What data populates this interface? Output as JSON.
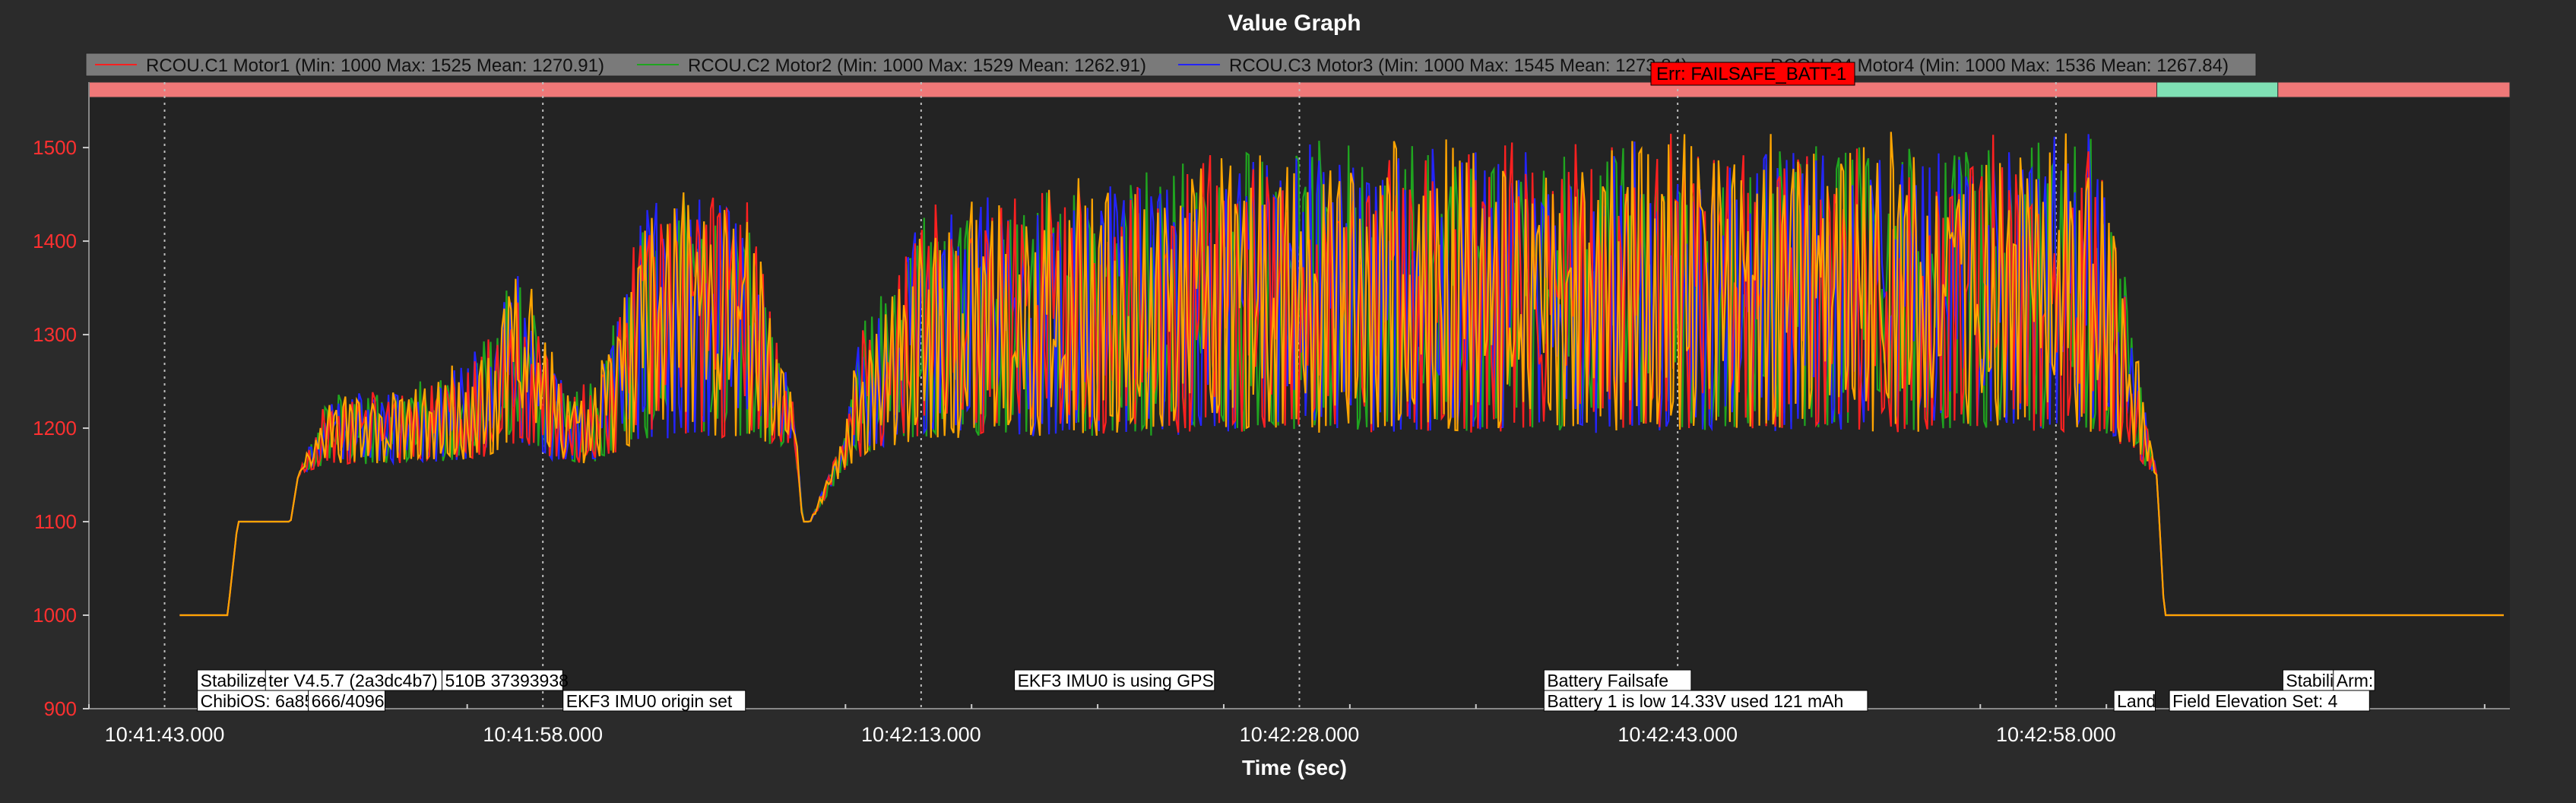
{
  "title": "Value Graph",
  "colors": {
    "background": "#2b2b2b",
    "plot_background": "#232323",
    "grid": "#bdbdbd",
    "ytick": "#ff3030",
    "xtick": "#ffffff",
    "legend_bg": "#7a7a7a",
    "mode_bar_red": "#f07878",
    "mode_bar_green": "#7fe0b4",
    "err_bg": "#ff0000"
  },
  "error_label": "Err: FAILSAFE_BATT-1",
  "chart_data": {
    "type": "line",
    "title": "Value Graph",
    "xlabel": "Time (sec)",
    "ylabel": "",
    "xlim": [
      "10:41:40.000",
      "10:43:16.000"
    ],
    "ylim": [
      900,
      1570
    ],
    "grid": true,
    "legend_placement": "top",
    "x_ticks": [
      "10:41:43.000",
      "10:41:58.000",
      "10:42:13.000",
      "10:42:28.000",
      "10:42:43.000",
      "10:42:58.000"
    ],
    "y_ticks": [
      900,
      1000,
      1100,
      1200,
      1300,
      1400,
      1500
    ],
    "series": [
      {
        "name": "RCOU.C1 Motor1 (Min: 1000 Max: 1525 Mean: 1270.91)",
        "color": "#ff2020"
      },
      {
        "name": "RCOU.C2 Motor2 (Min: 1000 Max: 1529 Mean: 1262.91)",
        "color": "#1fa51f"
      },
      {
        "name": "RCOU.C3 Motor3 (Min: 1000 Max: 1545 Mean: 1273.84)",
        "color": "#2424ff"
      },
      {
        "name": "RCOU.C4 Motor4 (Min: 1000 Max: 1536 Mean: 1267.84)",
        "color": "#ffa500"
      }
    ],
    "envelope": {
      "x": [
        "10:41:43.600",
        "10:41:45.500",
        "10:41:45.900",
        "10:41:48.000",
        "10:41:48.300",
        "10:41:49.500",
        "10:41:52.000",
        "10:41:54.000",
        "10:41:56.000",
        "10:41:57.000",
        "10:41:57.500",
        "10:41:58.000",
        "10:41:59.000",
        "10:42:00.000",
        "10:42:02.000",
        "10:42:03.000",
        "10:42:06.000",
        "10:42:08.000",
        "10:42:08.300",
        "10:42:08.600",
        "10:42:10.000",
        "10:42:10.500",
        "10:42:13.000",
        "10:42:16.000",
        "10:42:28.000",
        "10:42:58.000",
        "10:42:59.500",
        "10:43:00.500",
        "10:43:01.500",
        "10:43:02.000",
        "10:43:02.300",
        "10:43:15.800"
      ],
      "low": [
        1000,
        1000,
        1100,
        1100,
        1150,
        1150,
        1150,
        1150,
        1150,
        1150,
        1150,
        1150,
        1150,
        1150,
        1150,
        1150,
        1150,
        1170,
        1100,
        1100,
        1150,
        1150,
        1150,
        1150,
        1150,
        1150,
        1150,
        1150,
        1150,
        1150,
        1000,
        1000
      ],
      "high": [
        1000,
        1000,
        1100,
        1100,
        1150,
        1240,
        1240,
        1260,
        1300,
        1400,
        1380,
        1300,
        1250,
        1250,
        1450,
        1460,
        1460,
        1220,
        1100,
        1100,
        1200,
        1300,
        1440,
        1460,
        1510,
        1520,
        1520,
        1420,
        1230,
        1150,
        1000,
        1000
      ]
    },
    "mode_bar": {
      "segments": [
        {
          "start": "10:41:40.000",
          "end": "10:43:02.000",
          "color": "#f07878"
        },
        {
          "start": "10:43:02.000",
          "end": "10:43:06.800",
          "color": "#7fe0b4"
        },
        {
          "start": "10:43:06.800",
          "end": "10:43:16.000",
          "color": "#f07878"
        }
      ]
    },
    "annotations": [
      {
        "x": "10:41:44.300",
        "row": 0,
        "text": "Stabilize"
      },
      {
        "x": "10:41:47.000",
        "row": 0,
        "text": "ter V4.5.7 (2a3dc4b7)"
      },
      {
        "x": "10:41:54.000",
        "row": 0,
        "text": "510B 37393938"
      },
      {
        "x": "10:41:44.300",
        "row": 1,
        "text": "ChibiOS: 6a85082c"
      },
      {
        "x": "10:41:48.700",
        "row": 1,
        "text": "666/4096"
      },
      {
        "x": "10:41:58.800",
        "row": 1,
        "text": "EKF3 IMU0 origin set"
      },
      {
        "x": "10:42:16.700",
        "row": 0,
        "text": "EKF3 IMU0 is using GPS"
      },
      {
        "x": "10:42:37.700",
        "row": 0,
        "text": "Battery Failsafe"
      },
      {
        "x": "10:42:37.700",
        "row": 1,
        "text": "Battery 1 is low 14.33V used 121 mAh"
      },
      {
        "x": "10:43:00.300",
        "row": 1,
        "text": "Land"
      },
      {
        "x": "10:43:07.000",
        "row": 0,
        "text": "Stabilize"
      },
      {
        "x": "10:43:09.000",
        "row": 0,
        "text": "Arm:"
      },
      {
        "x": "10:43:02.500",
        "row": 1,
        "text": "Field Elevation Set: 4"
      }
    ]
  }
}
